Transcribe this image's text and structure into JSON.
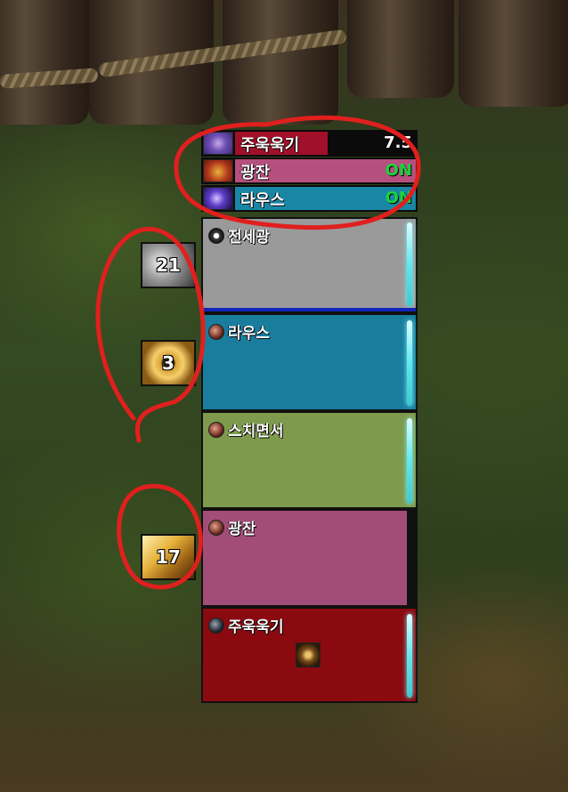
{
  "status_bars": [
    {
      "name": "주욱욱기",
      "value": "7.5",
      "bar_color": "#a1102a",
      "value_color": "#ffffff",
      "icon": "brain-swirl-icon"
    },
    {
      "name": "광잔",
      "value": "ON",
      "bar_color": "#b5507e",
      "value_color": "#19d43a",
      "icon": "raised-fist-icon"
    },
    {
      "name": "라우스",
      "value": "ON",
      "bar_color": "#1a86a6",
      "value_color": "#19d43a",
      "icon": "purple-orb-icon"
    }
  ],
  "side_cooldowns": [
    {
      "count": "21",
      "icon": "grey-ghost-icon"
    },
    {
      "count": "3",
      "icon": "golden-rune-disc-icon"
    },
    {
      "count": "17",
      "icon": "golden-shield-icon"
    }
  ],
  "buff_blocks": [
    {
      "label": "전세광",
      "color": "#9a9a9a",
      "icon": "plus-circle-icon"
    },
    {
      "label": "라우스",
      "color": "#1a7d9d",
      "icon": "red-dot-icon"
    },
    {
      "label": "스치면서",
      "color": "#7e9a4c",
      "icon": "red-dot-icon"
    },
    {
      "label": "광잔",
      "color": "#a24d78",
      "icon": "red-dot-icon"
    },
    {
      "label": "주욱욱기",
      "color": "#8a0a10",
      "icon": "black-swirl-icon"
    }
  ],
  "colors": {
    "annotation_red": "#e0201e",
    "glow_cyan": "#61e8ee",
    "separator_blue": "#1024b8"
  }
}
